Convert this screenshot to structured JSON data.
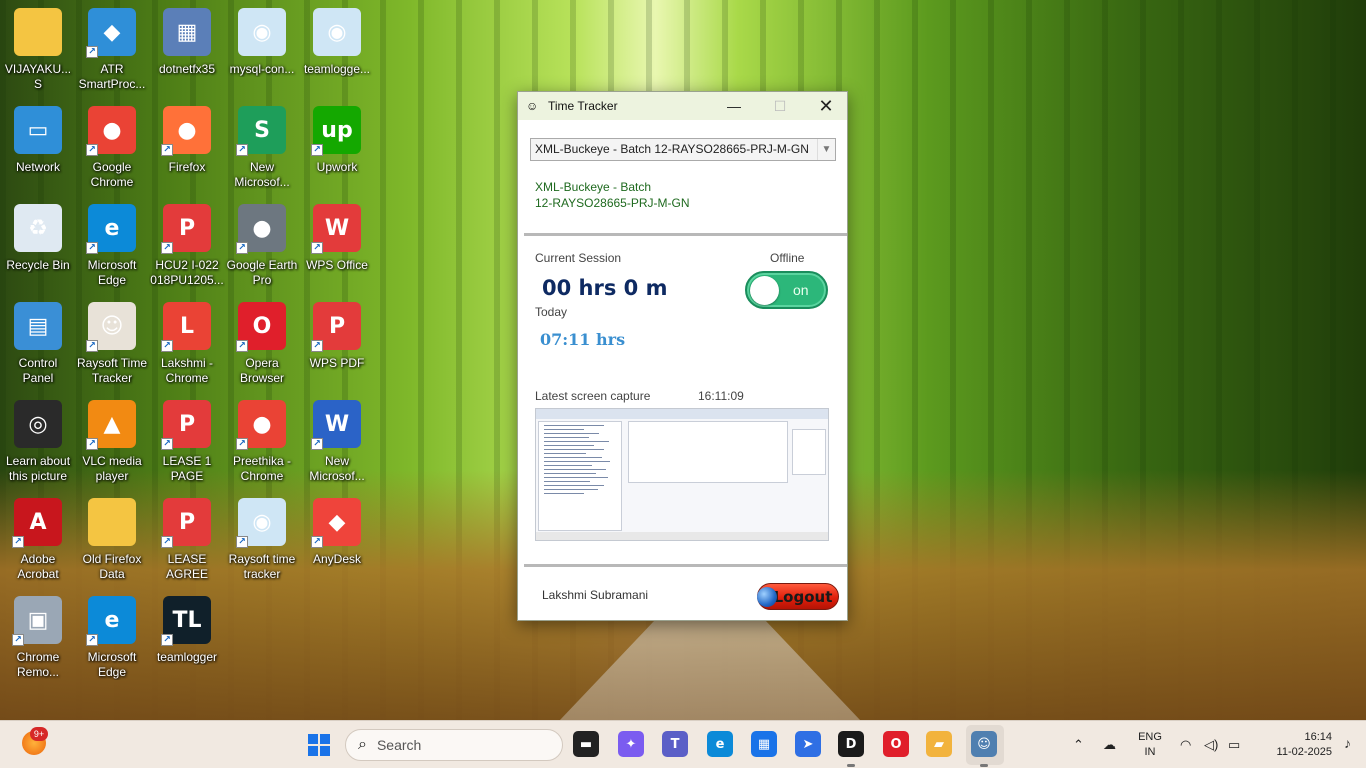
{
  "desktop": {
    "icons": [
      {
        "label": "VIJAYAKU...\nS",
        "color": "#f4c542",
        "glyph": "",
        "shortcut": false
      },
      {
        "label": "ATR\nSmartProc...",
        "color": "#2f8fd8",
        "glyph": "◆",
        "shortcut": true
      },
      {
        "label": "dotnetfx35",
        "color": "#5b7fb8",
        "glyph": "▦",
        "shortcut": false
      },
      {
        "label": "mysql-con...",
        "color": "#cfe6f5",
        "glyph": "◉",
        "shortcut": false
      },
      {
        "label": "teamlogge...",
        "color": "#cfe6f5",
        "glyph": "◉",
        "shortcut": false
      },
      {
        "label": "Network",
        "color": "#2f8fd8",
        "glyph": "▭",
        "shortcut": false
      },
      {
        "label": "Google\nChrome",
        "color": "#ea4335",
        "glyph": "●",
        "shortcut": true
      },
      {
        "label": "Firefox",
        "color": "#ff7139",
        "glyph": "●",
        "shortcut": true
      },
      {
        "label": "New\nMicrosof...",
        "color": "#1e9e5a",
        "glyph": "S",
        "shortcut": true
      },
      {
        "label": "Upwork",
        "color": "#14a800",
        "glyph": "up",
        "shortcut": true
      },
      {
        "label": "Recycle Bin",
        "color": "#dfe9f2",
        "glyph": "♻",
        "shortcut": false
      },
      {
        "label": "Microsoft\nEdge",
        "color": "#0c8ad8",
        "glyph": "e",
        "shortcut": true
      },
      {
        "label": "HCU2 I-022\n018PU1205...",
        "color": "#e33b3b",
        "glyph": "P",
        "shortcut": true
      },
      {
        "label": "Google Earth\nPro",
        "color": "#6d7780",
        "glyph": "●",
        "shortcut": true
      },
      {
        "label": "WPS Office",
        "color": "#e33b3b",
        "glyph": "W",
        "shortcut": true
      },
      {
        "label": "Control\nPanel",
        "color": "#3a8fd6",
        "glyph": "▤",
        "shortcut": false
      },
      {
        "label": "Raysoft Time\nTracker",
        "color": "#e8e2d8",
        "glyph": "☺",
        "shortcut": true
      },
      {
        "label": "Lakshmi -\nChrome",
        "color": "#ea4335",
        "glyph": "L",
        "shortcut": true
      },
      {
        "label": "Opera\nBrowser",
        "color": "#e01f2b",
        "glyph": "O",
        "shortcut": true
      },
      {
        "label": "WPS PDF",
        "color": "#e33b3b",
        "glyph": "P",
        "shortcut": true
      },
      {
        "label": "Learn about\nthis picture",
        "color": "#2a2a2a",
        "glyph": "◎",
        "shortcut": false
      },
      {
        "label": "VLC media\nplayer",
        "color": "#f28a12",
        "glyph": "▲",
        "shortcut": true
      },
      {
        "label": "LEASE 1\nPAGE",
        "color": "#e33b3b",
        "glyph": "P",
        "shortcut": true
      },
      {
        "label": "Preethika -\nChrome",
        "color": "#ea4335",
        "glyph": "●",
        "shortcut": true
      },
      {
        "label": "New\nMicrosof...",
        "color": "#2b63c7",
        "glyph": "W",
        "shortcut": true
      },
      {
        "label": "Adobe\nAcrobat",
        "color": "#c8161d",
        "glyph": "A",
        "shortcut": true
      },
      {
        "label": "Old Firefox\nData",
        "color": "#f4c542",
        "glyph": "",
        "shortcut": false
      },
      {
        "label": "LEASE AGREE",
        "color": "#e33b3b",
        "glyph": "P",
        "shortcut": true
      },
      {
        "label": "Raysoft time\ntracker",
        "color": "#cfe6f5",
        "glyph": "◉",
        "shortcut": true
      },
      {
        "label": "AnyDesk",
        "color": "#ef443b",
        "glyph": "◆",
        "shortcut": true
      },
      {
        "label": "Chrome\nRemo...",
        "color": "#9aa7b5",
        "glyph": "▣",
        "shortcut": true
      },
      {
        "label": "Microsoft\nEdge",
        "color": "#0c8ad8",
        "glyph": "e",
        "shortcut": true
      },
      {
        "label": "teamlogger",
        "color": "#10202a",
        "glyph": "TL",
        "shortcut": true
      }
    ]
  },
  "window": {
    "title": "Time Tracker",
    "minimize": "—",
    "maximize": "☐",
    "close": "✕",
    "project_select": "XML-Buckeye - Batch 12-RAYSO28665-PRJ-M-GN",
    "project_name": "XML-Buckeye - Batch\n12-RAYSO28665-PRJ-M-GN",
    "current_session_label": "Current Session",
    "status_label": "Offline",
    "session_time": "00 hrs 0 m",
    "toggle_state": "on",
    "today_label": "Today",
    "today_time": "07:11 hrs",
    "capture_label": "Latest screen capture",
    "capture_time": "16:11:09",
    "user_name": "Lakshmi Subramani",
    "logout_label": "Logout"
  },
  "taskbar": {
    "weather_badge": "9+",
    "search_placeholder": "Search",
    "apps": [
      {
        "name": "task-view",
        "glyph": "▬",
        "color": "#222222"
      },
      {
        "name": "copilot",
        "glyph": "✦",
        "color": "#7b5cf0"
      },
      {
        "name": "teams",
        "glyph": "T",
        "color": "#5b5fc7"
      },
      {
        "name": "edge",
        "glyph": "e",
        "color": "#0c8ad8"
      },
      {
        "name": "store",
        "glyph": "▦",
        "color": "#1a73e8"
      },
      {
        "name": "power-automate",
        "glyph": "➤",
        "color": "#2f6fe4"
      },
      {
        "name": "dell",
        "glyph": "D",
        "color": "#1b1b1b"
      },
      {
        "name": "opera",
        "glyph": "O",
        "color": "#e01f2b"
      },
      {
        "name": "file-explorer",
        "glyph": "▰",
        "color": "#f2b33d"
      },
      {
        "name": "time-tracker",
        "glyph": "☺",
        "color": "#4f7fb0"
      }
    ],
    "language": "ENG",
    "region": "IN",
    "time": "16:14",
    "date": "11-02-2025"
  }
}
